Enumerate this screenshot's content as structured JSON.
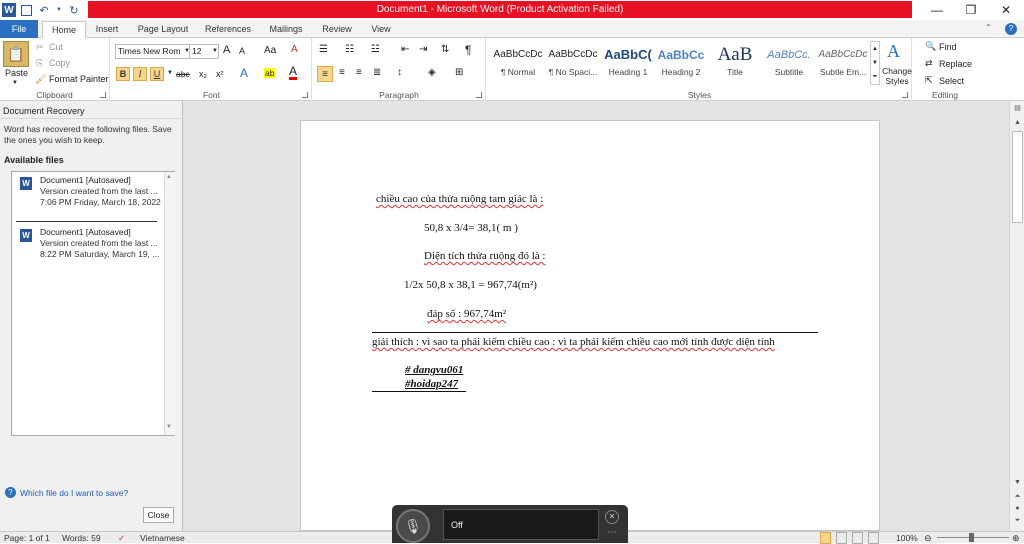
{
  "window": {
    "title": "Document1 - Microsoft Word (Product Activation Failed)",
    "min": "—",
    "max": "❐",
    "close": "✕"
  },
  "qat": {
    "word_icon": "W",
    "save_icon": "💾",
    "undo_icon": "↶",
    "redo_icon": "↻",
    "more_icon": "⏷"
  },
  "tabs": [
    "File",
    "Home",
    "Insert",
    "Page Layout",
    "References",
    "Mailings",
    "Review",
    "View"
  ],
  "ribbon": {
    "clipboard": {
      "label": "Clipboard",
      "paste": "Paste",
      "cut": "Cut",
      "copy": "Copy",
      "format_painter": "Format Painter"
    },
    "font": {
      "label": "Font",
      "family": "Times New Rom",
      "size": "12",
      "bold": "B",
      "italic": "I",
      "underline": "U",
      "strike": "abc",
      "sub": "x₂",
      "sup": "x²",
      "grow": "A",
      "shrink": "A",
      "case": "Aa",
      "clear": "A",
      "effects": "A",
      "highlight": "ab",
      "color": "A"
    },
    "paragraph": {
      "label": "Paragraph",
      "pilcrow": "¶"
    },
    "styles": {
      "label": "Styles",
      "items": [
        {
          "preview": "AaBbCcDc",
          "name": "¶ Normal"
        },
        {
          "preview": "AaBbCcDc",
          "name": "¶ No Spaci..."
        },
        {
          "preview": "AaBbC(",
          "name": "Heading 1"
        },
        {
          "preview": "AaBbCc",
          "name": "Heading 2"
        },
        {
          "preview": "AaB",
          "name": "Title"
        },
        {
          "preview": "AaBbCc.",
          "name": "Subtitle"
        },
        {
          "preview": "AaBbCcDc",
          "name": "Subtle Em..."
        }
      ],
      "change_styles": "Change Styles"
    },
    "editing": {
      "label": "Editing",
      "find": "Find",
      "replace": "Replace",
      "select": "Select"
    }
  },
  "pane": {
    "title": "Document Recovery",
    "desc": "Word has recovered the following files.  Save the ones you wish to keep.",
    "available": "Available files",
    "files": [
      {
        "name": "Document1  [Autosaved]",
        "line1": "Version created from the last ...",
        "line2": "7:06 PM Friday, March 18, 2022"
      },
      {
        "name": "Document1  [Autosaved]",
        "line1": "Version created from the last ...",
        "line2": "8:22 PM Saturday, March 19, ..."
      }
    ],
    "help": "Which file do I want to save?",
    "close": "Close"
  },
  "document": {
    "l1": "chiều cao của thửa ruộng tam giác là :",
    "l2": "50,8 x 3/4= 38,1( m )",
    "l3": "Diện tích thửa ruộng đó là :",
    "l4": "1/2x 50,8 x 38,1 = 967,74(m²)",
    "l5": "đáp số : 967,74m²",
    "l6": "giải thích : vì sao ta phải kiếm chiều cao : vì ta phải kiếm chiều cao mới tính được diện tính",
    "l7": "# dangvu061",
    "l8": "#hoidap247"
  },
  "status": {
    "page": "Page: 1 of 1",
    "words": "Words: 59",
    "language": "Vietnamese",
    "zoom": "100%"
  },
  "dictation": {
    "state": "Off"
  }
}
